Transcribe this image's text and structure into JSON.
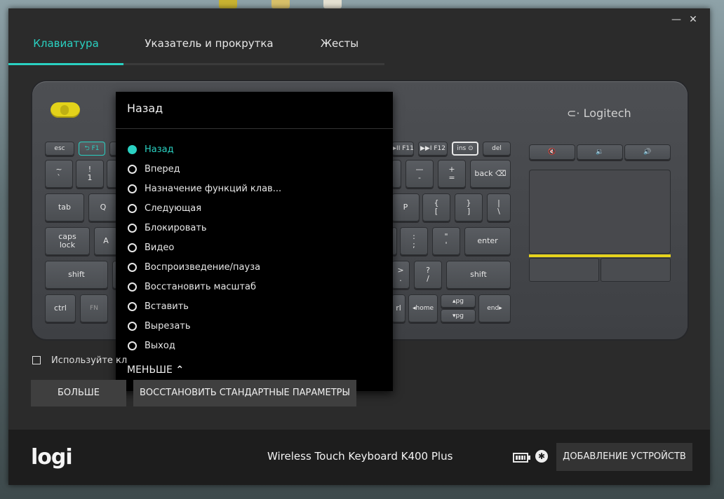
{
  "window": {
    "minimize_glyph": "—",
    "close_glyph": "✕"
  },
  "tabs": [
    {
      "label": "Клавиатура",
      "active": true
    },
    {
      "label": "Указатель и прокрутка",
      "active": false
    },
    {
      "label": "Жесты",
      "active": false
    }
  ],
  "keyboard": {
    "brand": "Logitech",
    "keys": {
      "esc": "esc",
      "f1": "⮌ F1",
      "f11": "▶II F11",
      "f12": "▶▶I F12",
      "ins": "ins ⊙",
      "del": "del",
      "tilde": "~\n`",
      "one": "!\n1",
      "minus": "—\n-",
      "plus": "+\n=",
      "back": "back ⌫",
      "tab": "tab",
      "q": "Q",
      "p": "P",
      "lbrace": "{\n[",
      "rbrace": "}\n]",
      "pipe": "|\n\\",
      "caps": "caps\nlock",
      "a": "A",
      "colon": ":\n;",
      "quote": "\"\n'",
      "enter": "enter",
      "lshift": "shift",
      "gt": ">\n.",
      "question": "?\n/",
      "rshift": "shift",
      "ctrl": "ctrl",
      "fn": "FN",
      "rl": "rl",
      "home": "◂home",
      "pgup": "▴pg",
      "pgdn": "▾pg",
      "end": "end▸",
      "mute": "🔇",
      "voldown": "🔉",
      "volup": "🔊"
    }
  },
  "dropdown": {
    "title": "Назад",
    "options": [
      {
        "label": "Назад",
        "selected": true
      },
      {
        "label": "Вперед",
        "selected": false
      },
      {
        "label": "Назначение функций клав...",
        "selected": false
      },
      {
        "label": "Следующая",
        "selected": false
      },
      {
        "label": "Блокировать",
        "selected": false
      },
      {
        "label": "Видео",
        "selected": false
      },
      {
        "label": "Воспроизведение/пауза",
        "selected": false
      },
      {
        "label": "Восстановить масштаб",
        "selected": false
      },
      {
        "label": "Вставить",
        "selected": false
      },
      {
        "label": "Вырезать",
        "selected": false
      },
      {
        "label": "Выход",
        "selected": false
      }
    ],
    "less_label": "МЕНЬШЕ",
    "less_icon": "⌃"
  },
  "options": {
    "checkbox_label": "Используйте кл",
    "more_button": "БОЛЬШЕ",
    "restore_button": "ВОССТАНОВИТЬ СТАНДАРТНЫЕ ПАРАМЕТРЫ"
  },
  "footer": {
    "logo": "logi",
    "device_name": "Wireless Touch Keyboard K400 Plus",
    "unifying_glyph": "✱",
    "add_devices_button": "ДОБАВЛЕНИЕ УСТРОЙСТВ"
  },
  "colors": {
    "accent": "#2ad1c2",
    "keyboard_yellow": "#e3d21a"
  }
}
